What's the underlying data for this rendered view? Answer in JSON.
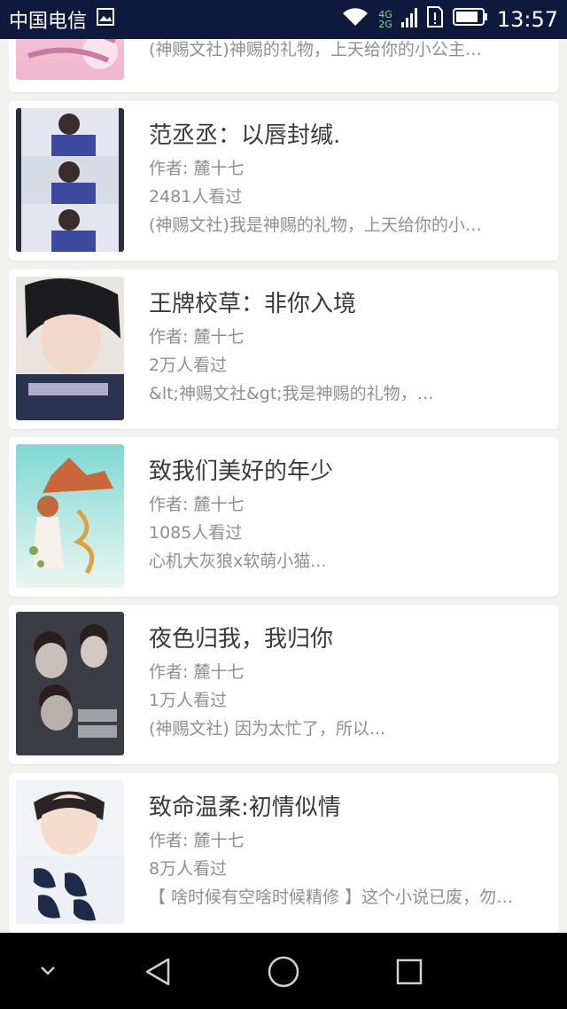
{
  "status_bar": {
    "carrier": "中国电信",
    "network_top": "4G",
    "network_bottom": "2G",
    "time": "13:57"
  },
  "books": [
    {
      "title": "",
      "author": "",
      "readers": "",
      "description": "(神赐文社)神赐的礼物，上天给你的小公主…",
      "cover_icon": "book-cover-pink"
    },
    {
      "title": "范丞丞：以唇封缄.",
      "author": "作者: 麓十七",
      "readers": "2481人看过",
      "description": "(神赐文社)我是神赐的礼物，上天给你的小…",
      "cover_icon": "book-cover-blue"
    },
    {
      "title": "王牌校草：非你入境",
      "author": "作者: 麓十七",
      "readers": "2万人看过",
      "description": "&lt;神赐文社&gt;我是神赐的礼物，…",
      "cover_icon": "book-cover-dark"
    },
    {
      "title": "致我们美好的年少",
      "author": "作者: 麓十七",
      "readers": "1085人看过",
      "description": "心机大灰狼x软萌小猫...",
      "cover_icon": "book-cover-teal"
    },
    {
      "title": "夜色归我，我归你",
      "author": "作者: 麓十七",
      "readers": "1万人看过",
      "description": "(神赐文社) 因为太忙了，所以...",
      "cover_icon": "book-cover-night"
    },
    {
      "title": "致命温柔:初情似情",
      "author": "作者: 麓十七",
      "readers": "8万人看过",
      "description": "【 啥时候有空啥时候精修 】这个小说已废，勿…",
      "cover_icon": "book-cover-white"
    }
  ],
  "colors": {
    "status_bar_bg": "#0d1a3d",
    "page_bg": "#f1f1ee",
    "title_text": "#3a3a3a",
    "meta_text": "#8f8f8f"
  }
}
